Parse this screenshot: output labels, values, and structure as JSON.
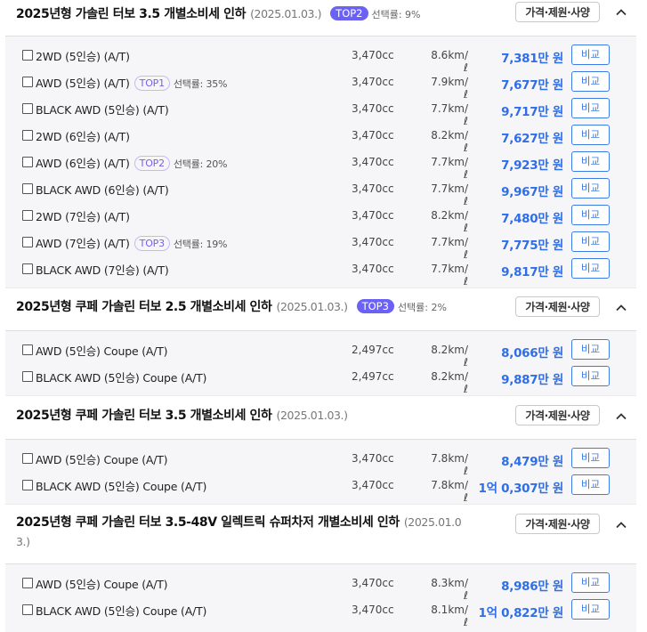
{
  "sections": [
    {
      "title": "2025년형 가솔린 터보 3.5 개별소비세 인하",
      "date": "(2025.01.03.)",
      "badge": "TOP2",
      "badge_rate": "선택률: 9%",
      "spec_button": "가격·제원·사양",
      "trims": [
        {
          "name": "2WD (5인승) (A/T)",
          "cc": "3,470cc",
          "fuel": "8.6km/ℓ",
          "price": "7,381만 원",
          "compare": "비교"
        },
        {
          "name": "AWD (5인승) (A/T)",
          "top": "TOP1",
          "rate": "선택률: 35%",
          "cc": "3,470cc",
          "fuel": "7.9km/ℓ",
          "price": "7,677만 원",
          "compare": "비교"
        },
        {
          "name": "BLACK AWD (5인승) (A/T)",
          "cc": "3,470cc",
          "fuel": "7.7km/ℓ",
          "price": "9,717만 원",
          "compare": "비교"
        },
        {
          "name": "2WD (6인승) (A/T)",
          "cc": "3,470cc",
          "fuel": "8.2km/ℓ",
          "price": "7,627만 원",
          "compare": "비교"
        },
        {
          "name": "AWD (6인승) (A/T)",
          "top": "TOP2",
          "rate": "선택률: 20%",
          "cc": "3,470cc",
          "fuel": "7.7km/ℓ",
          "price": "7,923만 원",
          "compare": "비교"
        },
        {
          "name": "BLACK AWD (6인승) (A/T)",
          "cc": "3,470cc",
          "fuel": "7.7km/ℓ",
          "price": "9,967만 원",
          "compare": "비교"
        },
        {
          "name": "2WD (7인승) (A/T)",
          "cc": "3,470cc",
          "fuel": "8.2km/ℓ",
          "price": "7,480만 원",
          "compare": "비교"
        },
        {
          "name": "AWD (7인승) (A/T)",
          "top": "TOP3",
          "rate": "선택률: 19%",
          "cc": "3,470cc",
          "fuel": "7.7km/ℓ",
          "price": "7,775만 원",
          "compare": "비교"
        },
        {
          "name": "BLACK AWD (7인승) (A/T)",
          "cc": "3,470cc",
          "fuel": "7.7km/ℓ",
          "price": "9,817만 원",
          "compare": "비교"
        }
      ]
    },
    {
      "title": "2025년형 쿠페 가솔린 터보 2.5 개별소비세 인하",
      "date": "(2025.01.03.)",
      "badge": "TOP3",
      "badge_rate": "선택률: 2%",
      "spec_button": "가격·제원·사양",
      "trims": [
        {
          "name": "AWD (5인승) Coupe (A/T)",
          "cc": "2,497cc",
          "fuel": "8.2km/ℓ",
          "price": "8,066만 원",
          "compare": "비교"
        },
        {
          "name": "BLACK AWD (5인승) Coupe (A/T)",
          "cc": "2,497cc",
          "fuel": "8.2km/ℓ",
          "price": "9,887만 원",
          "compare": "비교"
        }
      ]
    },
    {
      "title": "2025년형 쿠페 가솔린 터보 3.5 개별소비세 인하",
      "date": "(2025.01.03.)",
      "spec_button": "가격·제원·사양",
      "trims": [
        {
          "name": "AWD (5인승) Coupe (A/T)",
          "cc": "3,470cc",
          "fuel": "7.8km/ℓ",
          "price": "8,479만 원",
          "compare": "비교"
        },
        {
          "name": "BLACK AWD (5인승) Coupe (A/T)",
          "cc": "3,470cc",
          "fuel": "7.8km/ℓ",
          "price": "1억 0,307만 원",
          "compare": "비교"
        }
      ]
    },
    {
      "title": "2025년형 쿠페 가솔린 터보 3.5-48V 일렉트릭 슈퍼차저 개별소비세 인하",
      "date": "(2025.01.0",
      "date_tail": "3.)",
      "spec_button": "가격·제원·사양",
      "trims": [
        {
          "name": "AWD (5인승) Coupe (A/T)",
          "cc": "3,470cc",
          "fuel": "8.3km/ℓ",
          "price": "8,986만 원",
          "compare": "비교"
        },
        {
          "name": "BLACK AWD (5인승) Coupe (A/T)",
          "cc": "3,470cc",
          "fuel": "8.1km/ℓ",
          "price": "1억 0,822만 원",
          "compare": "비교"
        }
      ]
    }
  ],
  "icons": {
    "collapse": "chevron-up-icon",
    "checkbox": "checkbox-icon"
  },
  "colors": {
    "accent": "#2f6ee8",
    "badge_bg": "#6b61f5",
    "top_badge": "#7a5cf0",
    "list_bg": "#f6f6f8"
  }
}
